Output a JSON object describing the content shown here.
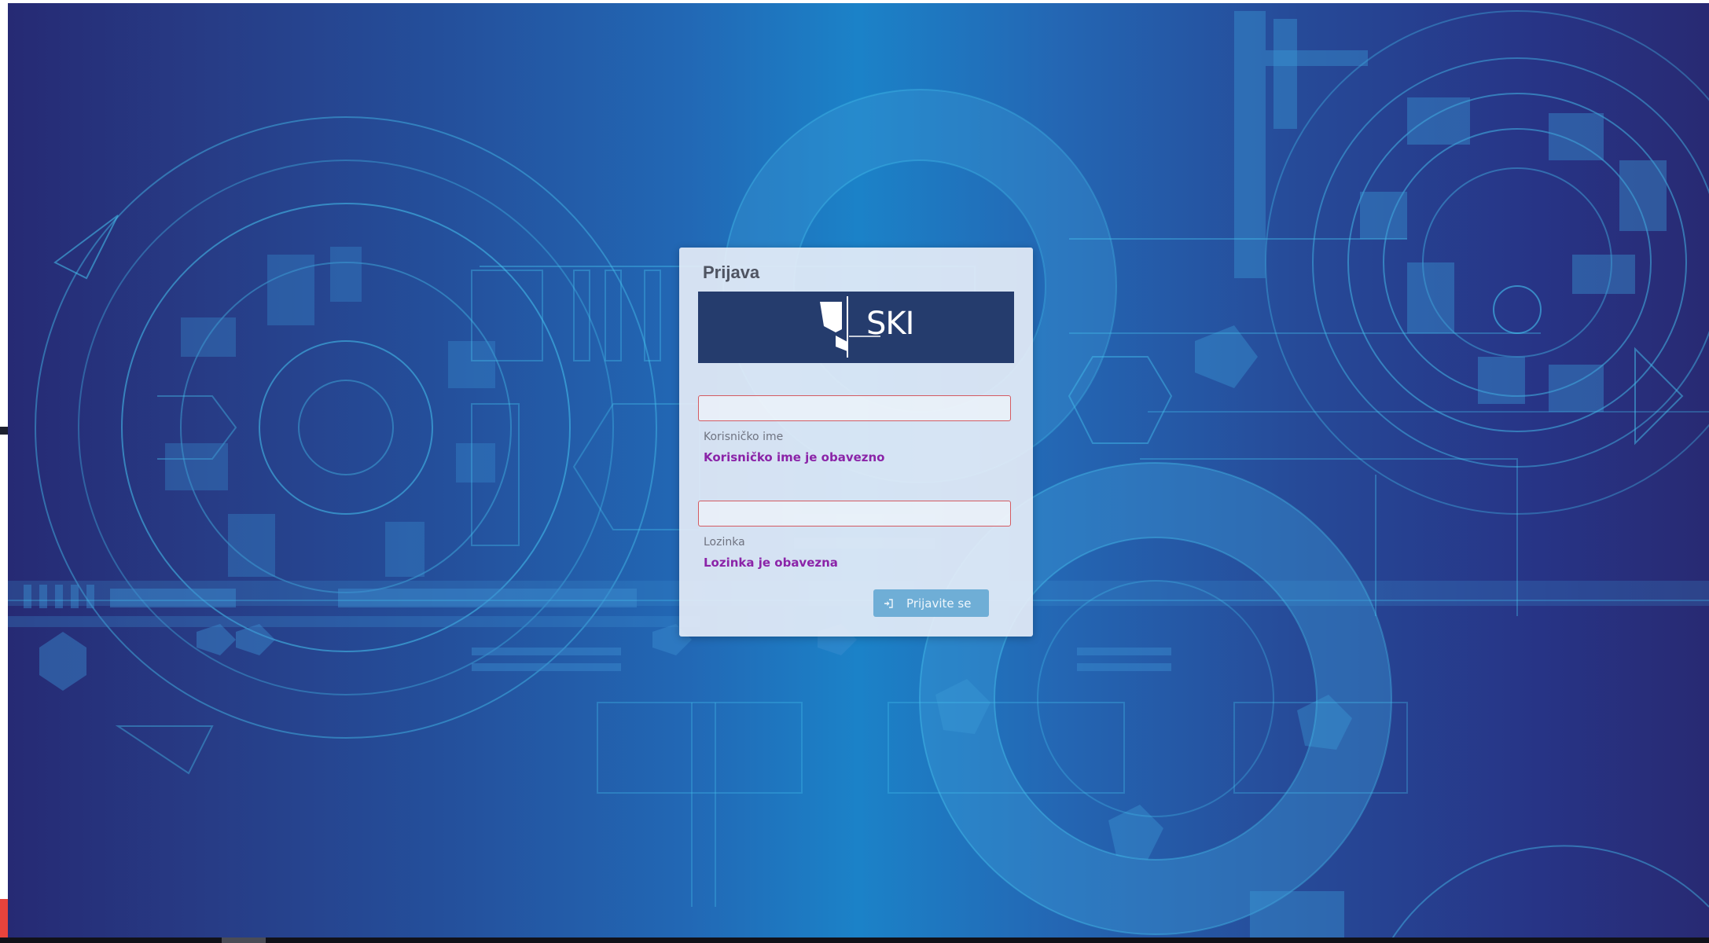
{
  "login": {
    "title": "Prijava",
    "logo_text": "SKI",
    "username": {
      "value": "",
      "label": "Korisničko ime",
      "error": "Korisničko ime je obavezno"
    },
    "password": {
      "value": "",
      "label": "Lozinka",
      "error": "Lozinka je obavezna"
    },
    "submit_label": "Prijavite se",
    "submit_icon": "sign-in-icon"
  },
  "colors": {
    "error_text": "#8b24a8",
    "input_border_error": "#d45b62",
    "button": "#6faed6",
    "logo_banner": "#253c6d"
  }
}
